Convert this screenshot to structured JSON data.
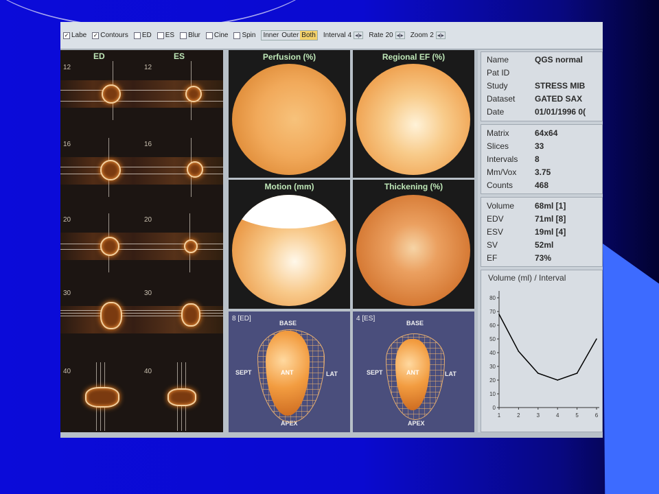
{
  "toolbar": {
    "checks": [
      {
        "label": "Labe",
        "checked": true
      },
      {
        "label": "Contours",
        "checked": true
      },
      {
        "label": "ED",
        "checked": false
      },
      {
        "label": "ES",
        "checked": false
      },
      {
        "label": "Blur",
        "checked": false
      },
      {
        "label": "Cine",
        "checked": false
      },
      {
        "label": "Spin",
        "checked": false
      }
    ],
    "surface": {
      "inner": "Inner",
      "outer": "Outer",
      "both": "Both",
      "selected": "Both"
    },
    "interval": {
      "label": "Interval",
      "value": "4"
    },
    "rate": {
      "label": "Rate",
      "value": "20"
    },
    "zoom": {
      "label": "Zoom",
      "value": "2"
    },
    "spin_arrows": "◂|▸"
  },
  "slices": {
    "ed_label": "ED",
    "es_label": "ES",
    "rows": [
      "12",
      "16",
      "20",
      "30",
      "40"
    ]
  },
  "panels": {
    "perfusion": "Perfusion (%)",
    "regional_ef": "Regional EF (%)",
    "motion": "Motion (mm)",
    "thickening": "Thickening (%)"
  },
  "models": {
    "ed": {
      "frame": "8 [ED]"
    },
    "es": {
      "frame": "4 [ES]"
    },
    "labels": {
      "base": "BASE",
      "sept": "SEPT",
      "ant": "ANT",
      "lat": "LAT",
      "apex": "APEX"
    }
  },
  "study_info": [
    {
      "k": "Name",
      "v": "QGS normal"
    },
    {
      "k": "Pat ID",
      "v": ""
    },
    {
      "k": "Study",
      "v": "STRESS MIB"
    },
    {
      "k": "Dataset",
      "v": "GATED SAX"
    },
    {
      "k": "Date",
      "v": "01/01/1996 0("
    }
  ],
  "acq_info": [
    {
      "k": "Matrix",
      "v": "64x64"
    },
    {
      "k": "Slices",
      "v": "33"
    },
    {
      "k": "Intervals",
      "v": "8"
    },
    {
      "k": "Mm/Vox",
      "v": "3.75"
    },
    {
      "k": "Counts",
      "v": "468"
    }
  ],
  "function_info": [
    {
      "k": "Volume",
      "v": "68ml [1]"
    },
    {
      "k": "EDV",
      "v": "71ml [8]"
    },
    {
      "k": "ESV",
      "v": "19ml [4]"
    },
    {
      "k": "SV",
      "v": "52ml"
    },
    {
      "k": "EF",
      "v": "73%"
    }
  ],
  "chart_data": {
    "type": "line",
    "title": "Volume (ml) / Interval",
    "xlabel": "",
    "ylabel": "",
    "x": [
      1,
      2,
      3,
      4,
      5,
      6
    ],
    "series": [
      {
        "values": [
          68,
          41,
          25,
          20,
          25,
          50
        ]
      }
    ],
    "xlim": [
      1,
      6
    ],
    "ylim": [
      0,
      85
    ],
    "yticks": [
      0,
      10,
      20,
      30,
      40,
      50,
      60,
      70,
      80
    ],
    "xticks": [
      1,
      2,
      3,
      4,
      5,
      6
    ],
    "grid": false,
    "line_color": "#000000"
  }
}
